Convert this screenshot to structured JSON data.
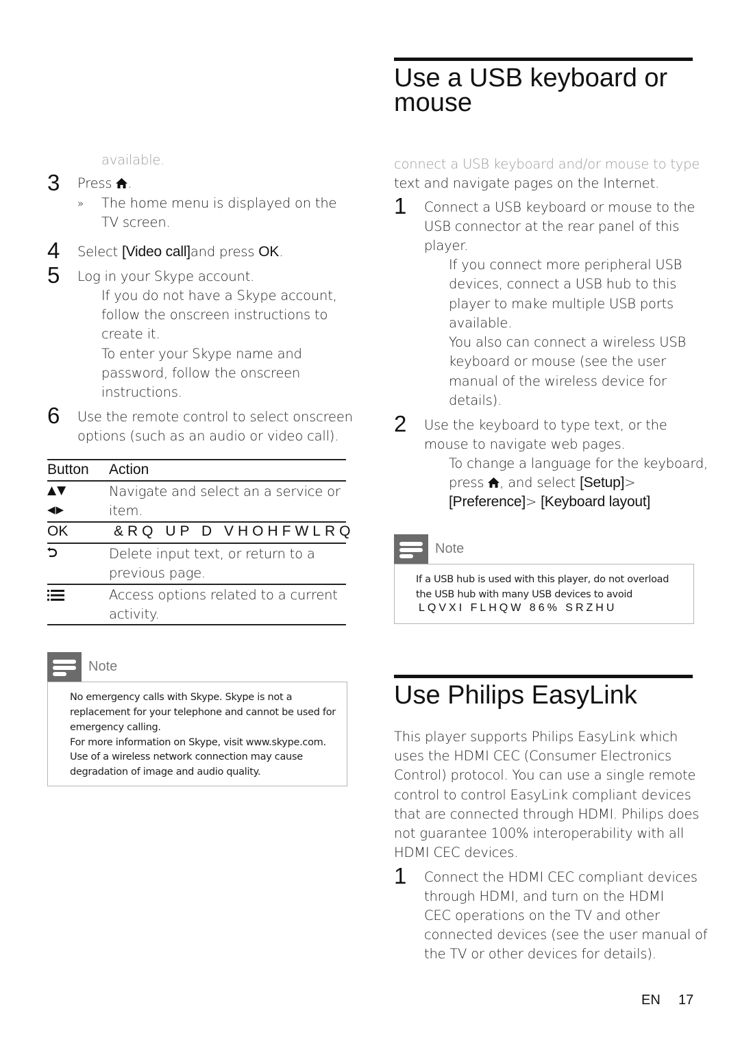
{
  "left": {
    "faded_top": "available.",
    "steps": [
      {
        "num": "3",
        "text_pre": "Press ",
        "icon": "home-icon",
        "text_post": ".",
        "result_marker": "»",
        "result": [
          "The home menu is displayed on the",
          "TV screen."
        ]
      },
      {
        "num": "4",
        "pre": "Select ",
        "bracket": "[Video call]",
        "mid": "and press ",
        "ok": "OK",
        "post": "."
      },
      {
        "num": "5",
        "text": "Log in your Skype account.",
        "sub": [
          "If you do not have a Skype account,",
          "follow the onscreen instructions to",
          "create it.",
          "To enter your Skype name and",
          "password, follow the onscreen",
          "instructions."
        ]
      },
      {
        "num": "6",
        "lines": [
          "Use the remote control to select onscreen",
          "options (such as an audio or video call)."
        ]
      }
    ],
    "table": {
      "headers": [
        "Button",
        "Action"
      ],
      "rows": [
        {
          "button_icons": [
            "up-down-arrows-icon",
            "left-right-arrows-icon"
          ],
          "button_glyphs": [
            "▲▼",
            "◀▶"
          ],
          "action": [
            "Navigate and select an a service or",
            "item."
          ]
        },
        {
          "button": "OK",
          "action": [
            "&RQ UP D VHOHFWLRQ"
          ]
        },
        {
          "button_icons": [
            "back-icon"
          ],
          "button_glyphs": [
            "↶"
          ],
          "action": [
            "Delete input text, or return to a",
            "previous page."
          ]
        },
        {
          "button_icons": [
            "options-icon"
          ],
          "button_glyphs": [
            "☰"
          ],
          "action": [
            "Access options related to a current",
            "activity."
          ]
        }
      ]
    },
    "note": {
      "label": "Note",
      "lines": [
        "No emergency calls with Skype. Skype is not a",
        "replacement for your telephone and cannot be used for",
        "emergency calling.",
        "For more information on Skype, visit www.skype.com.",
        "Use of a wireless network connection may cause",
        "degradation of image and audio quality."
      ]
    }
  },
  "right": {
    "section1": {
      "title_lines": [
        "Use a USB keyboard or",
        "mouse"
      ],
      "intro": [
        "connect a USB keyboard and/or mouse to type",
        "text and navigate pages on the Internet."
      ],
      "step1": {
        "num": "1",
        "lines": [
          "Connect a USB keyboard or mouse to the",
          "USB connector at the rear panel of this",
          "player."
        ],
        "sub": [
          "If you connect more peripheral USB",
          "devices, connect a USB hub to this",
          "player to make multiple USB ports",
          "available.",
          "You also can connect a wireless USB",
          "keyboard or mouse (see the user",
          "manual of the wireless device for",
          "details)."
        ]
      },
      "step2": {
        "num": "2",
        "lines": [
          "Use the keyboard to type text, or the",
          "mouse to navigate web pages."
        ],
        "sub1": "To change a language for the keyboard,",
        "sub2_pre": "press ",
        "sub2_mid": ", and select ",
        "setup": "[Setup]",
        "gt1": ">",
        "preference": "[Preference]",
        "gt2": ">",
        "keyboard_layout": "[Keyboard layout]"
      },
      "note": {
        "label": "Note",
        "lines": [
          "If a USB hub is used with this player, do not overload",
          "the USB hub with many USB devices to avoid"
        ],
        "garbled": "LQVXI FLHQW 86% SRZHU"
      }
    },
    "section2": {
      "title": "Use Philips EasyLink",
      "intro": [
        "This player supports Philips EasyLink which",
        "uses the HDMI CEC (Consumer Electronics",
        "Control) protocol. You can use a single remote",
        "control to control EasyLink compliant devices",
        "that are connected through HDMI. Philips does",
        "not guarantee 100% interoperability with all",
        "HDMI CEC devices."
      ],
      "step1": {
        "num": "1",
        "lines": [
          "Connect the HDMI CEC compliant devices",
          "through HDMI, and turn on the HDMI",
          "CEC operations on the TV and other",
          "connected devices (see the user manual of",
          "the TV or other devices for details)."
        ]
      }
    }
  },
  "footer": {
    "lang": "EN",
    "page": "17"
  }
}
